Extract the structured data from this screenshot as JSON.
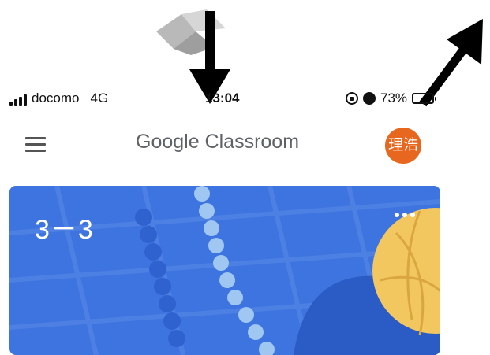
{
  "status_bar": {
    "carrier": "docomo",
    "network": "4G",
    "time": "13:04",
    "battery": "73%",
    "battery_level": 0.73,
    "icons": [
      "signal-icon",
      "orientation-lock-icon",
      "alarm-icon",
      "battery-icon"
    ]
  },
  "app_bar": {
    "title": "Google Classroom",
    "avatar_text": "理浩",
    "avatar_color": "#e8671f",
    "menu_icon": "menu-icon"
  },
  "class_card": {
    "name": "3－3",
    "background_color": "#3e74df",
    "more_icon": "more-options-icon"
  },
  "annotations": [
    "arrow-down-icon",
    "arrow-up-right-icon"
  ]
}
